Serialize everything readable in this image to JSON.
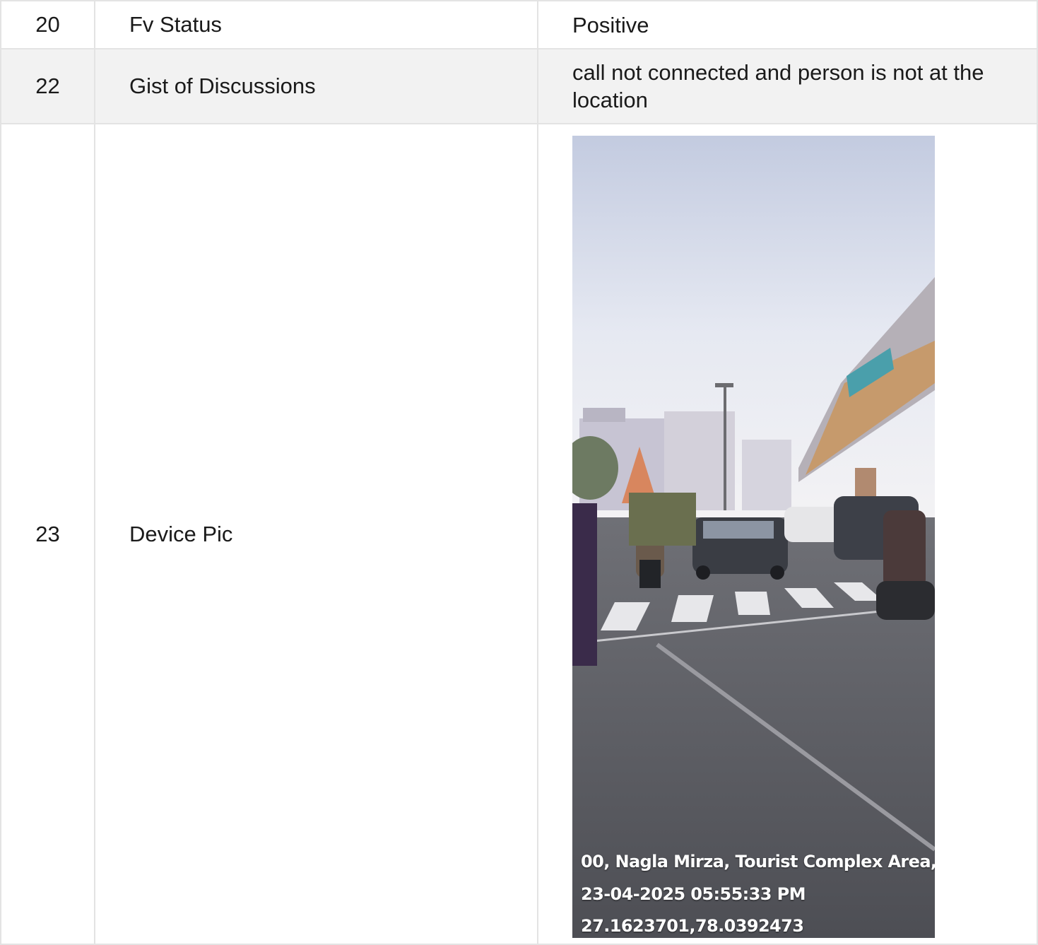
{
  "rows": [
    {
      "num": "20",
      "label": "Fv Status",
      "value": "Positive"
    },
    {
      "num": "22",
      "label": "Gist of Discussions",
      "value": "call not connected and person is not at the location"
    },
    {
      "num": "23",
      "label": "Device Pic",
      "value": ""
    }
  ],
  "device_pic": {
    "address": "00, Nagla Mirza, Tourist Complex Area, ...",
    "datetime": "23-04-2025 05:55:33 PM",
    "coordinates": "27.1623701,78.0392473"
  }
}
